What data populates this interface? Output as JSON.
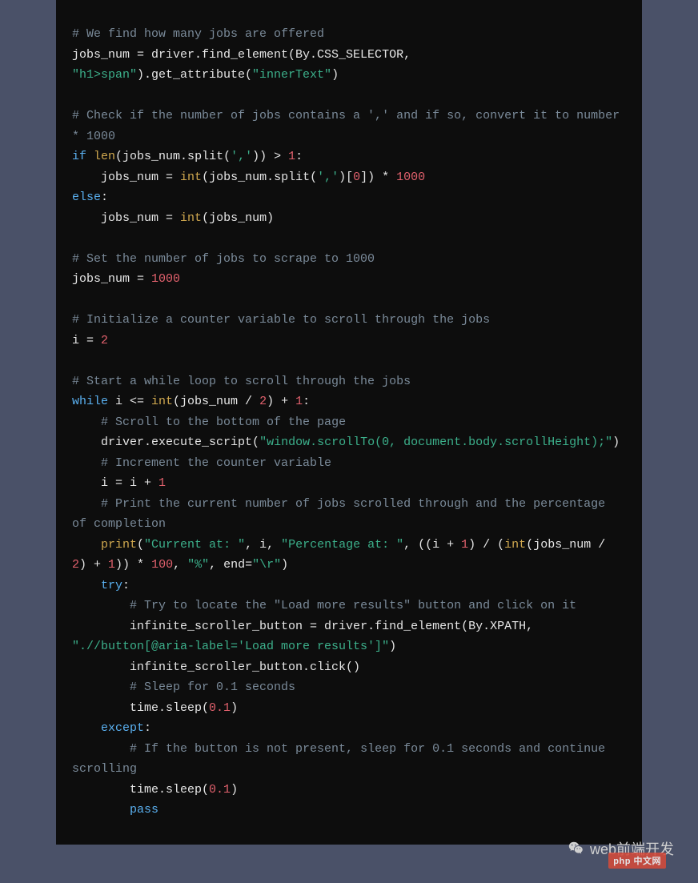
{
  "code": {
    "lines": [
      {
        "type": "comment",
        "text": "# We find how many jobs are offered"
      },
      {
        "type": "code",
        "html": "jobs_num = driver.find_element(By.CSS_SELECTOR,"
      },
      {
        "type": "code",
        "html": "<span class='str'>\"h1>span\"</span>).get_attribute(<span class='str'>\"innerText\"</span>)"
      },
      {
        "type": "blank"
      },
      {
        "type": "comment",
        "text": "# Check if the number of jobs contains a ',' and if so, convert it to number * 1000"
      },
      {
        "type": "code",
        "html": "<span class='kw'>if</span> <span class='builtin'>len</span>(jobs_num.split(<span class='str'>','</span>)) > <span class='num'>1</span>:"
      },
      {
        "type": "code",
        "html": "    jobs_num = <span class='builtin'>int</span>(jobs_num.split(<span class='str'>','</span>)[<span class='num'>0</span>]) * <span class='num'>1000</span>"
      },
      {
        "type": "code",
        "html": "<span class='kw'>else</span>:"
      },
      {
        "type": "code",
        "html": "    jobs_num = <span class='builtin'>int</span>(jobs_num)"
      },
      {
        "type": "blank"
      },
      {
        "type": "comment",
        "text": "# Set the number of jobs to scrape to 1000"
      },
      {
        "type": "code",
        "html": "jobs_num = <span class='num'>1000</span>"
      },
      {
        "type": "blank"
      },
      {
        "type": "comment",
        "text": "# Initialize a counter variable to scroll through the jobs"
      },
      {
        "type": "code",
        "html": "i = <span class='num'>2</span>"
      },
      {
        "type": "blank"
      },
      {
        "type": "comment",
        "text": "# Start a while loop to scroll through the jobs"
      },
      {
        "type": "code",
        "html": "<span class='kw'>while</span> i <= <span class='builtin'>int</span>(jobs_num / <span class='num'>2</span>) + <span class='num'>1</span>:"
      },
      {
        "type": "comment",
        "text": "    # Scroll to the bottom of the page"
      },
      {
        "type": "code",
        "html": "    driver.execute_script(<span class='str'>\"window.scrollTo(0, document.body.scrollHeight);\"</span>)"
      },
      {
        "type": "comment",
        "text": "    # Increment the counter variable"
      },
      {
        "type": "code",
        "html": "    i = i + <span class='num'>1</span>"
      },
      {
        "type": "comment",
        "text": "    # Print the current number of jobs scrolled through and the percentage of completion"
      },
      {
        "type": "code",
        "html": "    <span class='builtin'>print</span>(<span class='str'>\"Current at: \"</span>, i, <span class='str'>\"Percentage at: \"</span>, ((i + <span class='num'>1</span>) / (<span class='builtin'>int</span>(jobs_num / <span class='num'>2</span>) + <span class='num'>1</span>)) * <span class='num'>100</span>, <span class='str'>\"%\"</span>, end=<span class='str'>\"\\r\"</span>)"
      },
      {
        "type": "code",
        "html": "    <span class='kw'>try</span>:"
      },
      {
        "type": "comment",
        "text": "        # Try to locate the \"Load more results\" button and click on it"
      },
      {
        "type": "code",
        "html": "        infinite_scroller_button = driver.find_element(By.XPATH, <span class='str'>\".//button[@aria-label='Load more results']\"</span>)"
      },
      {
        "type": "code",
        "html": "        infinite_scroller_button.click()"
      },
      {
        "type": "comment",
        "text": "        # Sleep for 0.1 seconds"
      },
      {
        "type": "code",
        "html": "        time.sleep(<span class='num'>0.1</span>)"
      },
      {
        "type": "code",
        "html": "    <span class='kw'>except</span>:"
      },
      {
        "type": "comment",
        "text": "        # If the button is not present, sleep for 0.1 seconds and continue scrolling"
      },
      {
        "type": "code",
        "html": "        time.sleep(<span class='num'>0.1</span>)"
      },
      {
        "type": "code",
        "html": "        <span class='kw'>pass</span>"
      }
    ]
  },
  "footer": {
    "text": "web前端开发"
  },
  "watermark": {
    "text": "php 中文网"
  }
}
